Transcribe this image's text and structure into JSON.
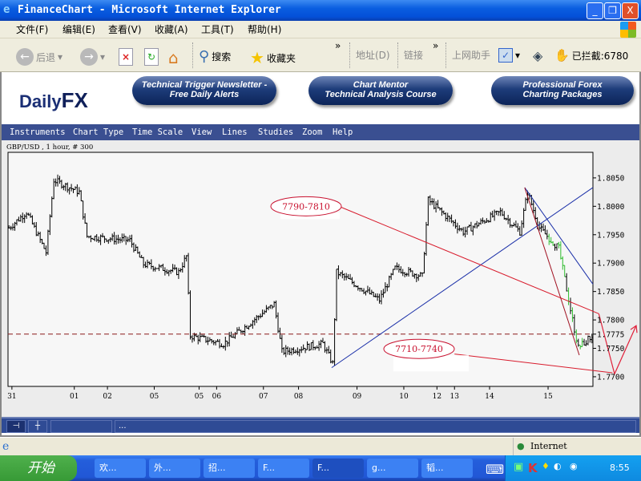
{
  "window": {
    "title": "FinanceChart - Microsoft Internet Explorer",
    "minimize": "_",
    "maximize": "❐",
    "close": "X"
  },
  "menu": [
    "文件(F)",
    "编辑(E)",
    "查看(V)",
    "收藏(A)",
    "工具(T)",
    "帮助(H)"
  ],
  "toolbar": {
    "back": "后退",
    "search": "搜索",
    "favorites": "收藏夹",
    "more1": "»",
    "address": "地址(D)",
    "links": "链接",
    "more2": "»",
    "assistant": "上网助手",
    "blocked": "已拦截:6780"
  },
  "header": {
    "logo_a": "Daily",
    "logo_b": "FX",
    "promos": [
      [
        "Technical Trigger Newsletter -",
        "Free Daily Alerts"
      ],
      [
        "Chart Mentor",
        "Technical Analysis Course"
      ],
      [
        "Professional Forex",
        "Charting Packages"
      ]
    ]
  },
  "app_menu": [
    "Instruments",
    "Chart Type",
    "Time Scale",
    "View",
    "Lines",
    "Studies",
    "Zoom",
    "Help"
  ],
  "chart_label": "GBP/USD , 1 hour, # 300",
  "bottom_bar": {
    "status": "..."
  },
  "status_bar": {
    "zone": "Internet"
  },
  "taskbar": {
    "start": "开始",
    "tasks": [
      "欢...",
      "外...",
      "招...",
      "F...",
      "F...",
      "g...",
      "韬..."
    ],
    "clock": "8:55"
  },
  "chart_data": {
    "type": "line",
    "title": "GBP/USD , 1 hour, # 300",
    "ylim": [
      1.7683,
      1.8095
    ],
    "xlim": [
      0,
      300
    ],
    "yticks": [
      "1.8050",
      "1.8000",
      "1.7950",
      "1.7900",
      "1.7850",
      "1.7800",
      "1.7775",
      "1.7750",
      "1.7700"
    ],
    "ytick_values": [
      1.805,
      1.8,
      1.795,
      1.79,
      1.785,
      1.78,
      1.7775,
      1.775,
      1.77
    ],
    "xticks": [
      {
        "label": "31",
        "bar": 2
      },
      {
        "label": "01",
        "bar": 34
      },
      {
        "label": "02",
        "bar": 51
      },
      {
        "label": "05",
        "bar": 75
      },
      {
        "label": "05",
        "bar": 98
      },
      {
        "label": "06",
        "bar": 107
      },
      {
        "label": "07",
        "bar": 131
      },
      {
        "label": "08",
        "bar": 149
      },
      {
        "label": "09",
        "bar": 179
      },
      {
        "label": "10",
        "bar": 203
      },
      {
        "label": "12",
        "bar": 220
      },
      {
        "label": "13",
        "bar": 229
      },
      {
        "label": "14",
        "bar": 247
      },
      {
        "label": "15",
        "bar": 277
      }
    ],
    "price_path": [
      [
        0,
        1.7962
      ],
      [
        9,
        1.799
      ],
      [
        19,
        1.7919
      ],
      [
        23,
        1.8046
      ],
      [
        36,
        1.8025
      ],
      [
        40,
        1.7947
      ],
      [
        62,
        1.794
      ],
      [
        69,
        1.7898
      ],
      [
        87,
        1.7884
      ],
      [
        91,
        1.7912
      ],
      [
        93,
        1.7772
      ],
      [
        110,
        1.7758
      ],
      [
        136,
        1.7828
      ],
      [
        140,
        1.7744
      ],
      [
        161,
        1.7758
      ],
      [
        166,
        1.7723
      ],
      [
        168,
        1.7884
      ],
      [
        190,
        1.7835
      ],
      [
        198,
        1.7891
      ],
      [
        212,
        1.7877
      ],
      [
        215,
        1.8011
      ],
      [
        233,
        1.7955
      ],
      [
        252,
        1.799
      ],
      [
        262,
        1.7955
      ],
      [
        266,
        1.8025
      ],
      [
        272,
        1.7962
      ],
      [
        282,
        1.7926
      ],
      [
        289,
        1.78
      ],
      [
        292,
        1.7751
      ],
      [
        299,
        1.7772
      ]
    ],
    "horizontal_line": 1.7775,
    "trendlines": [
      {
        "color": "#1a2fa8",
        "from": [
          166,
          1.7716
        ],
        "to": [
          300,
          1.8033
        ]
      },
      {
        "color": "#1a2fa8",
        "from": [
          265,
          1.8033
        ],
        "to": [
          300,
          1.7863
        ]
      },
      {
        "color": "#d81b2c",
        "from": [
          169,
          1.8001
        ],
        "to": [
          303,
          1.7811
        ]
      },
      {
        "color": "#d81b2c",
        "from": [
          229,
          1.774
        ],
        "to": [
          310,
          1.7707
        ]
      },
      {
        "color": "#a01020",
        "from": [
          265,
          1.8033
        ],
        "to": [
          293,
          1.7738
        ]
      }
    ],
    "annotations": [
      {
        "text": "7790-7810",
        "color": "#c8102e"
      },
      {
        "text": "7710-7740",
        "color": "#c8102e"
      }
    ]
  }
}
